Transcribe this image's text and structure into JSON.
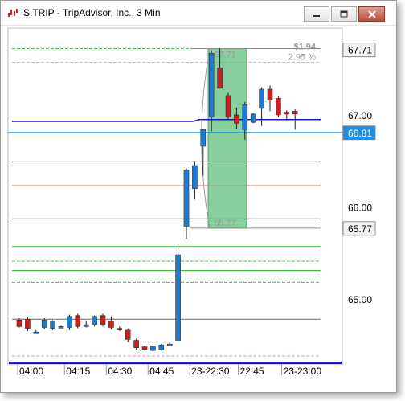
{
  "window": {
    "title": "S.TRIP - TripAdvisor, Inc., 3 Min"
  },
  "colors": {
    "up_candle": "#1e7bd2",
    "down_candle": "#cc1f1f",
    "price_line": "#1a1ab4",
    "current_price_bg": "#1e8fe6",
    "measure_fill": "#5fbf7f"
  },
  "chart_data": {
    "type": "candlestick",
    "title": "",
    "ylim": [
      64.3,
      67.98
    ],
    "y_ticks": [
      "67.00",
      "66.00",
      "65.00"
    ],
    "x_ticks": [
      "04:00",
      "04:15",
      "04:30",
      "04:45",
      "23-22:30",
      "22:45",
      "23-23:00"
    ],
    "price_labels": {
      "high": "67.71",
      "current": "66.81",
      "low": "65.77"
    },
    "measure": {
      "high_label": "67.71",
      "low_label": "65.77",
      "change": "$1.94",
      "change_pct": "2.95 %"
    },
    "candles": [
      {
        "o": 64.77,
        "h": 64.79,
        "l": 64.69,
        "c": 64.7
      },
      {
        "o": 64.78,
        "h": 64.8,
        "l": 64.65,
        "c": 64.68
      },
      {
        "o": 64.64,
        "h": 64.66,
        "l": 64.63,
        "c": 64.64
      },
      {
        "o": 64.69,
        "h": 64.79,
        "l": 64.67,
        "c": 64.77
      },
      {
        "o": 64.68,
        "h": 64.77,
        "l": 64.66,
        "c": 64.76
      },
      {
        "o": 64.7,
        "h": 64.71,
        "l": 64.69,
        "c": 64.7
      },
      {
        "o": 64.69,
        "h": 64.83,
        "l": 64.66,
        "c": 64.81
      },
      {
        "o": 64.82,
        "h": 64.84,
        "l": 64.68,
        "c": 64.7
      },
      {
        "o": 64.7,
        "h": 64.76,
        "l": 64.69,
        "c": 64.72
      },
      {
        "o": 64.72,
        "h": 64.82,
        "l": 64.7,
        "c": 64.81
      },
      {
        "o": 64.82,
        "h": 64.84,
        "l": 64.7,
        "c": 64.72
      },
      {
        "o": 64.76,
        "h": 64.81,
        "l": 64.67,
        "c": 64.69
      },
      {
        "o": 64.68,
        "h": 64.7,
        "l": 64.65,
        "c": 64.67
      },
      {
        "o": 64.66,
        "h": 64.68,
        "l": 64.53,
        "c": 64.56
      },
      {
        "o": 64.55,
        "h": 64.57,
        "l": 64.45,
        "c": 64.47
      },
      {
        "o": 64.48,
        "h": 64.49,
        "l": 64.44,
        "c": 64.45
      },
      {
        "o": 64.44,
        "h": 64.51,
        "l": 64.43,
        "c": 64.49
      },
      {
        "o": 64.45,
        "h": 64.51,
        "l": 64.44,
        "c": 64.5
      },
      {
        "o": 64.51,
        "h": 64.53,
        "l": 64.49,
        "c": 64.51
      },
      {
        "o": 64.55,
        "h": 65.56,
        "l": 64.55,
        "c": 65.48
      },
      {
        "o": 65.79,
        "h": 66.42,
        "l": 65.65,
        "c": 66.4
      },
      {
        "o": 66.2,
        "h": 66.5,
        "l": 66.08,
        "c": 66.45
      },
      {
        "o": 66.66,
        "h": 66.85,
        "l": 66.34,
        "c": 66.84
      },
      {
        "o": 66.98,
        "h": 67.7,
        "l": 66.82,
        "c": 67.67
      },
      {
        "o": 67.51,
        "h": 67.72,
        "l": 67.29,
        "c": 67.29
      },
      {
        "o": 67.21,
        "h": 67.24,
        "l": 66.95,
        "c": 66.98
      },
      {
        "o": 67.0,
        "h": 67.08,
        "l": 66.85,
        "c": 66.91
      },
      {
        "o": 66.84,
        "h": 67.14,
        "l": 66.73,
        "c": 67.11
      },
      {
        "o": 66.92,
        "h": 67.02,
        "l": 66.91,
        "c": 67.01
      },
      {
        "o": 67.07,
        "h": 67.3,
        "l": 66.88,
        "c": 67.28
      },
      {
        "o": 67.28,
        "h": 67.32,
        "l": 67.04,
        "c": 67.16
      },
      {
        "o": 67.18,
        "h": 67.2,
        "l": 66.98,
        "c": 67.0
      },
      {
        "o": 67.03,
        "h": 67.05,
        "l": 66.94,
        "c": 67.01
      },
      {
        "o": 67.04,
        "h": 67.06,
        "l": 66.84,
        "c": 67.01
      }
    ],
    "levels": [
      {
        "price": 67.72,
        "color": "#3cc43c",
        "style": "dashed"
      },
      {
        "price": 67.57,
        "color": "#d98fd9",
        "style": "dashed"
      },
      {
        "price": 66.49,
        "color": "#7b1e7b",
        "style": "solid"
      },
      {
        "price": 66.23,
        "color": "#d42a2a",
        "style": "solid"
      },
      {
        "price": 65.87,
        "color": "#000000",
        "style": "solid"
      },
      {
        "price": 65.57,
        "color": "#3cc43c",
        "style": "solid"
      },
      {
        "price": 65.41,
        "color": "#3cc43c",
        "style": "dashed"
      },
      {
        "price": 65.31,
        "color": "#22c722",
        "style": "solid"
      },
      {
        "price": 65.18,
        "color": "#3cc43c",
        "style": "dashed"
      },
      {
        "price": 64.78,
        "color": "#6a6a6a",
        "style": "solid"
      },
      {
        "price": 64.38,
        "color": "#d98fd9",
        "style": "dashed"
      }
    ]
  }
}
